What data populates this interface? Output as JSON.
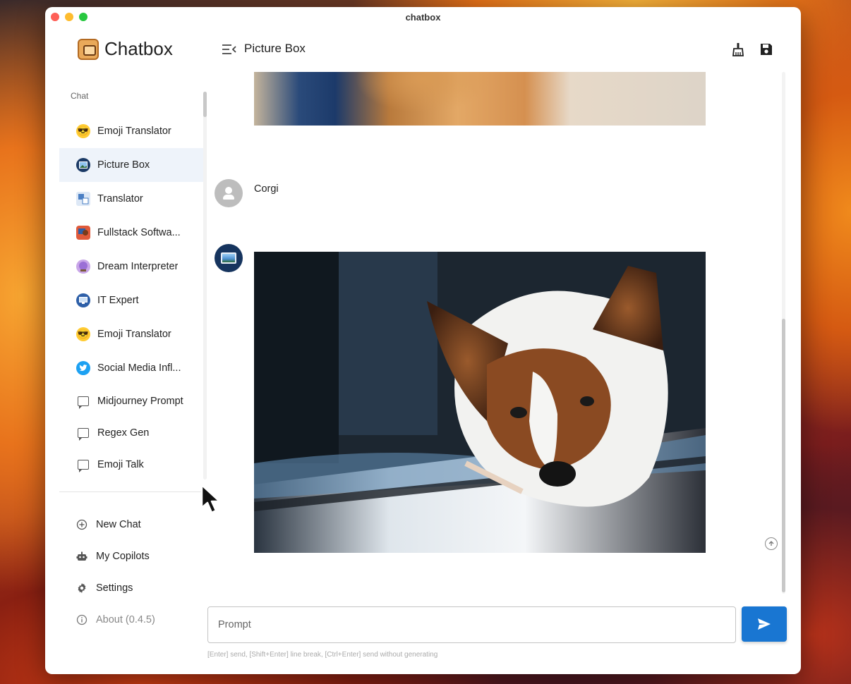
{
  "window": {
    "title": "chatbox"
  },
  "brand": {
    "name": "Chatbox"
  },
  "sidebar": {
    "section_label": "Chat",
    "chats": [
      {
        "label": "Emoji Translator",
        "icon": "sunglasses-emoji-icon"
      },
      {
        "label": "Picture Box",
        "icon": "picture-box-avatar-icon",
        "active": true
      },
      {
        "label": "Translator",
        "icon": "translator-avatar-icon"
      },
      {
        "label": "Fullstack Softwa...",
        "icon": "developer-avatar-icon"
      },
      {
        "label": "Dream Interpreter",
        "icon": "crystal-ball-icon"
      },
      {
        "label": "IT Expert",
        "icon": "it-expert-avatar-icon"
      },
      {
        "label": "Emoji Translator",
        "icon": "sunglasses-emoji-icon"
      },
      {
        "label": "Social Media Infl...",
        "icon": "twitter-bird-icon"
      },
      {
        "label": "Midjourney Prompt",
        "icon": "message-icon"
      },
      {
        "label": "Regex Gen",
        "icon": "message-icon"
      },
      {
        "label": "Emoji Talk",
        "icon": "message-icon"
      }
    ],
    "menu": {
      "new_chat": "New Chat",
      "my_copilots": "My Copilots",
      "settings": "Settings",
      "about": "About (0.4.5)"
    }
  },
  "header": {
    "title": "Picture Box"
  },
  "messages": [
    {
      "role": "assistant",
      "type": "image",
      "content": "orange cat photo (partially scrolled)"
    },
    {
      "role": "user",
      "text": "Corgi"
    },
    {
      "role": "assistant",
      "type": "image",
      "content": "corgi dog photo"
    }
  ],
  "composer": {
    "placeholder": "Prompt",
    "hint": "[Enter] send, [Shift+Enter] line break, [Ctrl+Enter] send without generating"
  },
  "colors": {
    "accent": "#1976d2",
    "active_item_bg": "#eef3fa"
  }
}
